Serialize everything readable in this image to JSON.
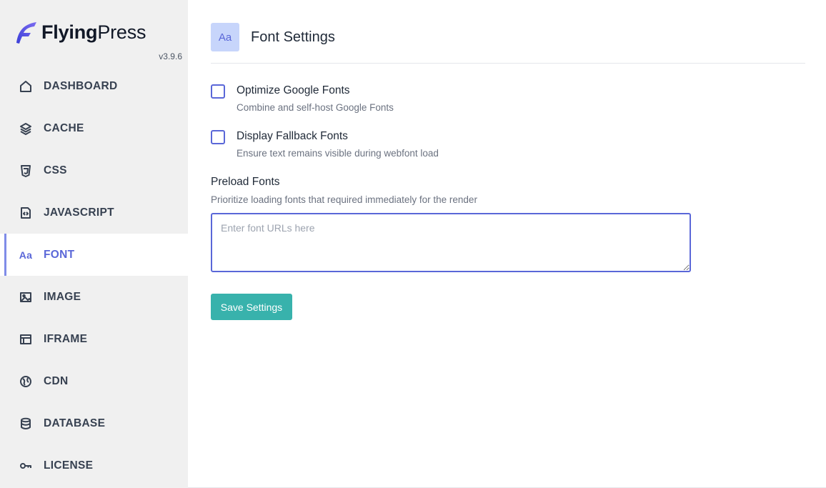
{
  "brand": {
    "name_bold": "Flying",
    "name_light": "Press",
    "version": "v3.9.6"
  },
  "sidebar": {
    "items": [
      {
        "label": "DASHBOARD",
        "icon": "home-icon",
        "active": false
      },
      {
        "label": "CACHE",
        "icon": "layers-icon",
        "active": false
      },
      {
        "label": "CSS",
        "icon": "css3-icon",
        "active": false
      },
      {
        "label": "JAVASCRIPT",
        "icon": "code-file-icon",
        "active": false
      },
      {
        "label": "FONT",
        "icon": "font-icon",
        "active": true
      },
      {
        "label": "IMAGE",
        "icon": "image-icon",
        "active": false
      },
      {
        "label": "IFRAME",
        "icon": "browser-window-icon",
        "active": false
      },
      {
        "label": "CDN",
        "icon": "globe-icon",
        "active": false
      },
      {
        "label": "DATABASE",
        "icon": "database-icon",
        "active": false
      },
      {
        "label": "LICENSE",
        "icon": "key-icon",
        "active": false
      }
    ]
  },
  "header": {
    "icon_text": "Aa",
    "title": "Font Settings"
  },
  "options": {
    "optimize": {
      "label": "Optimize Google Fonts",
      "description": "Combine and self-host Google Fonts",
      "checked": false
    },
    "fallback": {
      "label": "Display Fallback Fonts",
      "description": "Ensure text remains visible during webfont load",
      "checked": false
    }
  },
  "preload": {
    "label": "Preload Fonts",
    "description": "Prioritize loading fonts that required immediately for the render",
    "placeholder": "Enter font URLs here",
    "value": ""
  },
  "actions": {
    "save_label": "Save Settings"
  },
  "colors": {
    "accent": "#5a67d8",
    "button": "#38b2ac",
    "sidebar_bg": "#f0f0f0",
    "header_icon_bg": "#c7d5fb"
  }
}
